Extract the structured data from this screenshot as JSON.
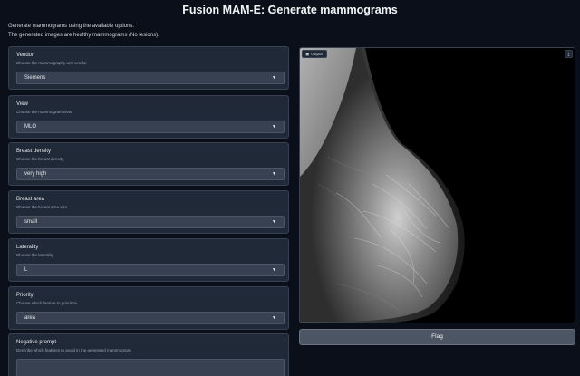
{
  "app": {
    "title": "Fusion MAM-E: Generate mammograms",
    "description": "Generate mammograms using the available options.",
    "note": "The generated images are healthy mammograms (No lesions)."
  },
  "fields": [
    {
      "label": "Vendor",
      "info": "Choose the mammography unit vendor",
      "value": "Siemens"
    },
    {
      "label": "View",
      "info": "Choose the mammogram view",
      "value": "MLO"
    },
    {
      "label": "Breast density",
      "info": "Choose the breast density",
      "value": "very high"
    },
    {
      "label": "Breast area",
      "info": "Choose the breast area size",
      "value": "small"
    },
    {
      "label": "Laterality",
      "info": "Choose the laterality",
      "value": "L"
    },
    {
      "label": "Priority",
      "info": "Choose which feature to prioritize",
      "value": "area"
    },
    {
      "label": "Negative prompt",
      "info": "Describe which features to avoid in the generated mammogram",
      "value": ""
    }
  ],
  "output": {
    "label": "output"
  },
  "flag_button": "Flag",
  "icons": {
    "output_tag": "image-icon",
    "download": "download-icon",
    "dropdown": "chevron-down-icon"
  }
}
